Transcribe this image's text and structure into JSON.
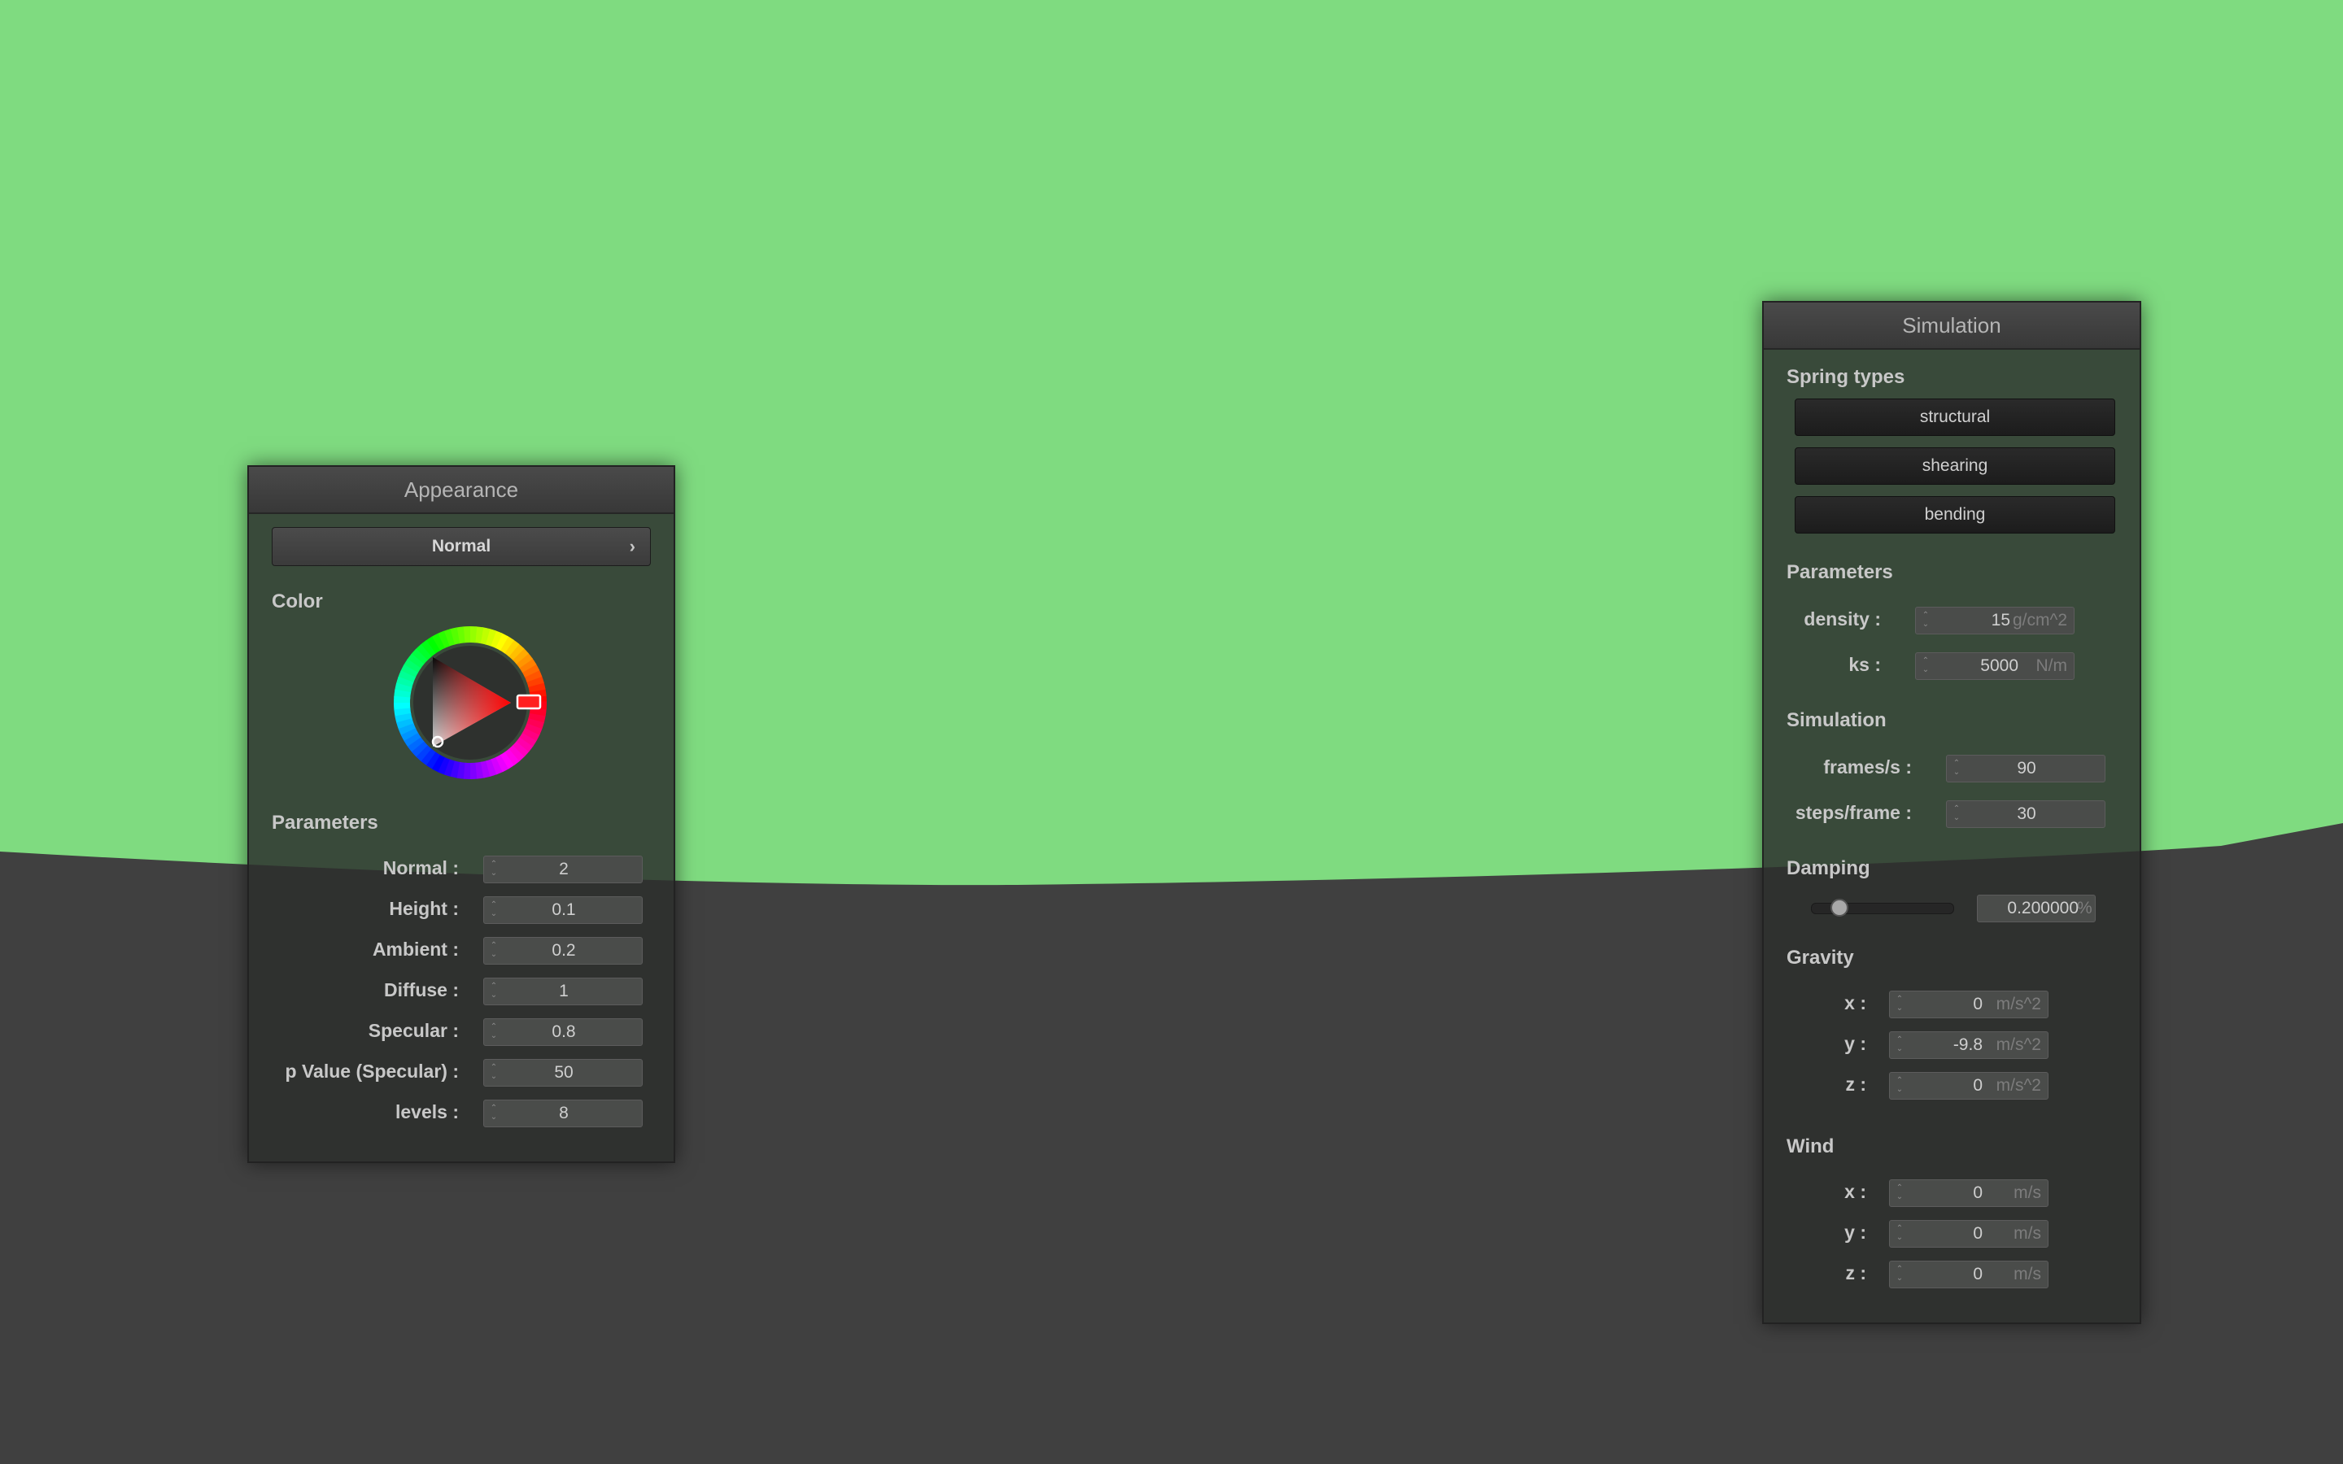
{
  "colors": {
    "background": "#7fdb80",
    "ground": "#404040",
    "panel": "#2c2f2c"
  },
  "appearance": {
    "title": "Appearance",
    "mode_select": "Normal",
    "color_label": "Color",
    "parameters_label": "Parameters",
    "params": [
      {
        "label": "Normal :",
        "value": "2"
      },
      {
        "label": "Height :",
        "value": "0.1"
      },
      {
        "label": "Ambient :",
        "value": "0.2"
      },
      {
        "label": "Diffuse :",
        "value": "1"
      },
      {
        "label": "Specular :",
        "value": "0.8"
      },
      {
        "label": "p Value (Specular) :",
        "value": "50"
      },
      {
        "label": "levels :",
        "value": "8"
      }
    ],
    "selected_color": "#ff0000"
  },
  "simulation": {
    "title": "Simulation",
    "spring_types_label": "Spring types",
    "spring_buttons": [
      "structural",
      "shearing",
      "bending"
    ],
    "parameters_label": "Parameters",
    "density": {
      "label": "density :",
      "value": "15",
      "unit": "g/cm^2"
    },
    "ks": {
      "label": "ks :",
      "value": "5000",
      "unit": "N/m"
    },
    "simulation_label": "Simulation",
    "frames": {
      "label": "frames/s :",
      "value": "90"
    },
    "steps": {
      "label": "steps/frame :",
      "value": "30"
    },
    "damping_label": "Damping",
    "damping": {
      "value": "0.200000",
      "unit": "%",
      "fraction": 0.2
    },
    "gravity_label": "Gravity",
    "gravity": [
      {
        "label": "x :",
        "value": "0",
        "unit": "m/s^2"
      },
      {
        "label": "y :",
        "value": "-9.8",
        "unit": "m/s^2"
      },
      {
        "label": "z :",
        "value": "0",
        "unit": "m/s^2"
      }
    ],
    "wind_label": "Wind",
    "wind": [
      {
        "label": "x :",
        "value": "0",
        "unit": "m/s"
      },
      {
        "label": "y :",
        "value": "0",
        "unit": "m/s"
      },
      {
        "label": "z :",
        "value": "0",
        "unit": "m/s"
      }
    ]
  }
}
